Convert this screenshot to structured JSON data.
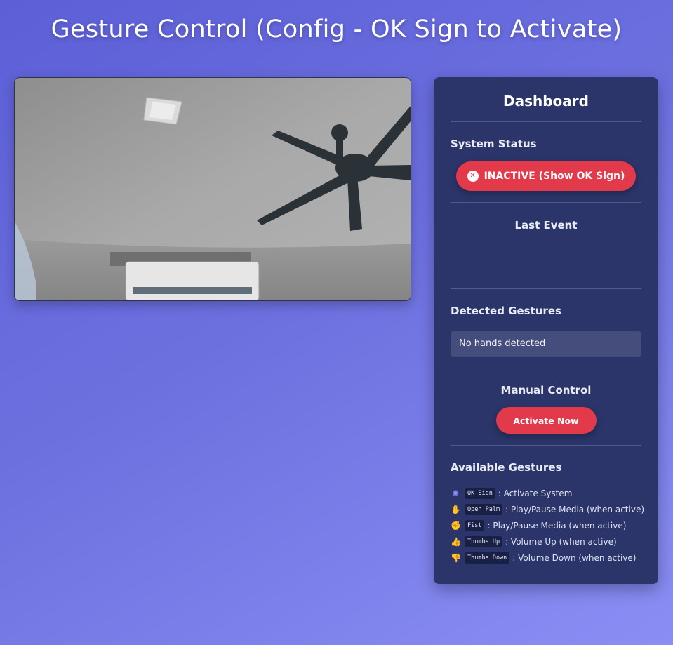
{
  "page": {
    "title": "Gesture Control (Config - OK Sign to Activate)"
  },
  "camera": {
    "description_icon": "camera-feed"
  },
  "dashboard": {
    "title": "Dashboard",
    "system_status": {
      "heading": "System Status",
      "badge_label": "INACTIVE (Show OK Sign)",
      "badge_icon": "x-circle-icon",
      "badge_color": "#e23a4b"
    },
    "last_event": {
      "heading": "Last Event",
      "value": ""
    },
    "detected": {
      "heading": "Detected Gestures",
      "value": "No hands detected"
    },
    "manual": {
      "heading": "Manual Control",
      "button_label": "Activate Now"
    },
    "available": {
      "heading": "Available Gestures",
      "items": [
        {
          "icon": "ok-sign-icon",
          "glyph": "✺",
          "code": "OK Sign",
          "desc": ": Activate System"
        },
        {
          "icon": "open-palm-icon",
          "glyph": "✋",
          "code": "Open Palm",
          "desc": ": Play/Pause Media (when active)"
        },
        {
          "icon": "fist-icon",
          "glyph": "✊",
          "code": "Fist",
          "desc": ": Play/Pause Media (when active)"
        },
        {
          "icon": "thumbs-up-icon",
          "glyph": "👍",
          "code": "Thumbs Up",
          "desc": ": Volume Up (when active)"
        },
        {
          "icon": "thumbs-down-icon",
          "glyph": "👎",
          "code": "Thumbs Down",
          "desc": ": Volume Down (when active)"
        }
      ]
    }
  },
  "colors": {
    "accent_red": "#e23a4b",
    "panel_bg": "#2b3569",
    "icon_purple": "#8f95ff"
  }
}
